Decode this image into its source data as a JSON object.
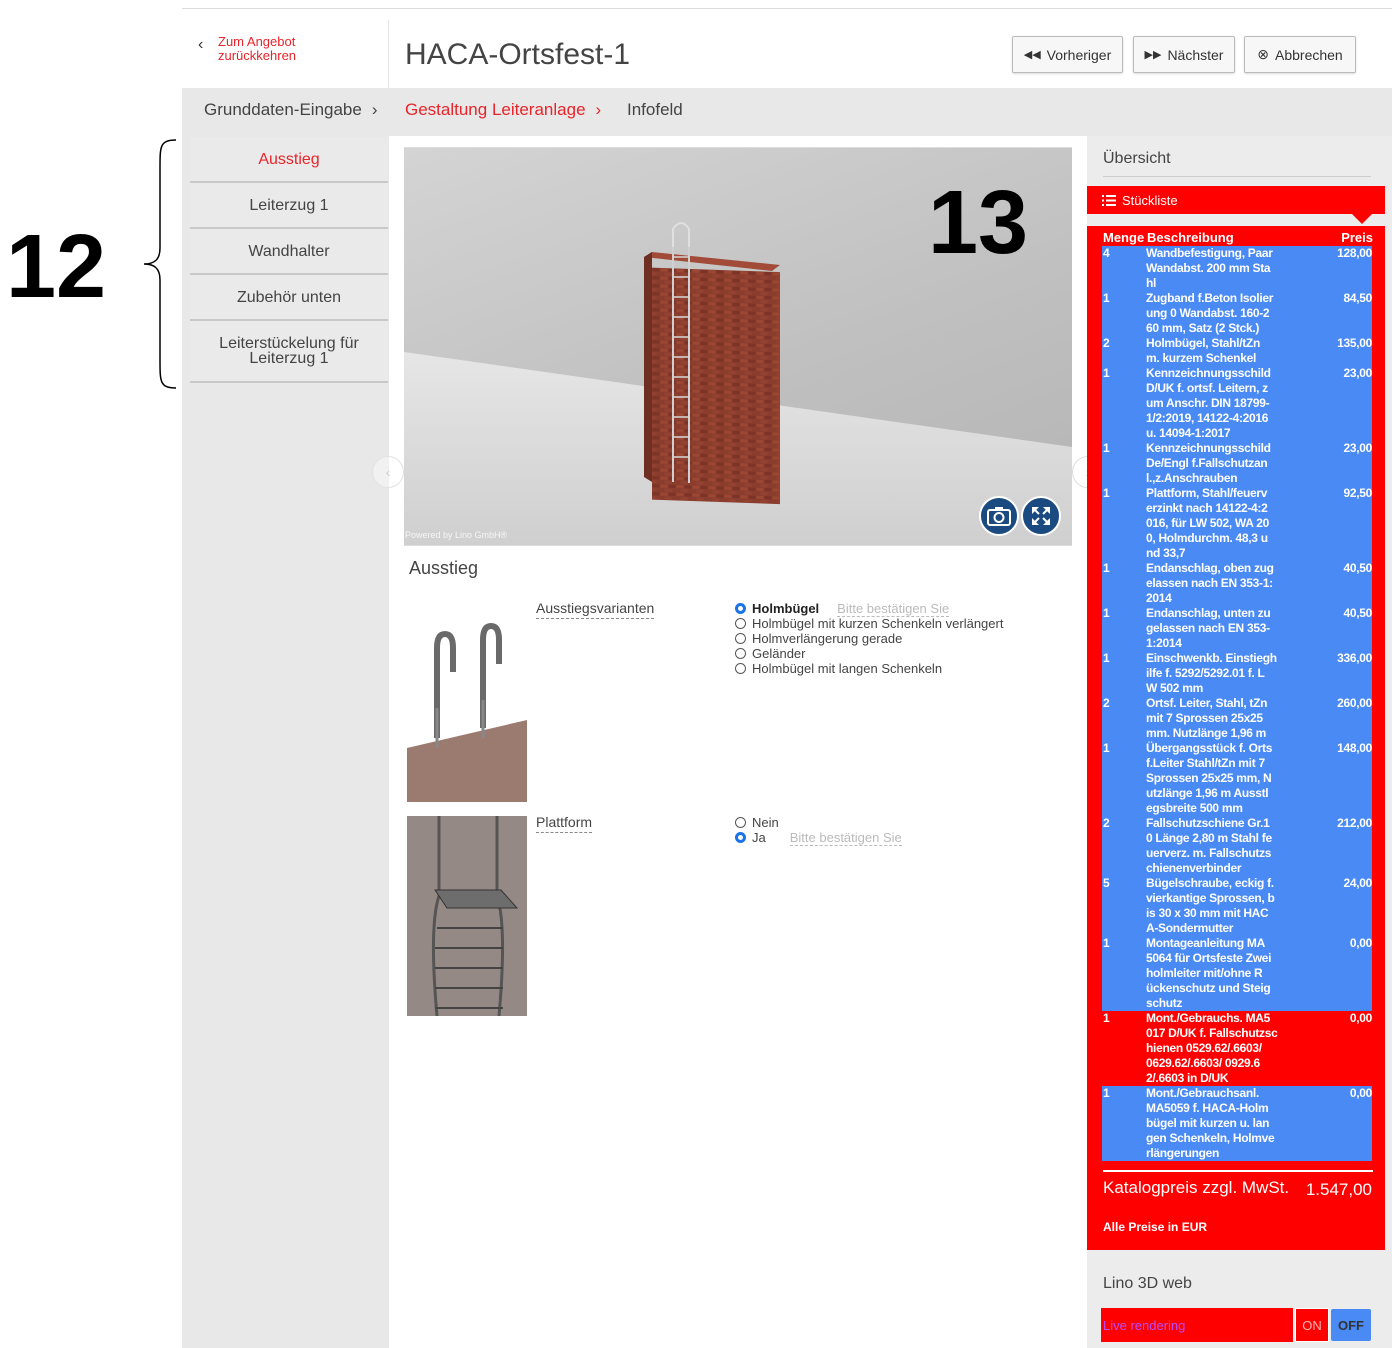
{
  "annotations": {
    "left": "12",
    "viewer": "13"
  },
  "header": {
    "back_label": "Zum Angebot zurückkehren",
    "title": "HACA-Ortsfest-1",
    "buttons": {
      "prev": "Vorheriger",
      "next": "Nächster",
      "cancel": "Abbrechen"
    }
  },
  "breadcrumb": {
    "steps": [
      {
        "label": "Grunddaten-Eingabe",
        "active": false
      },
      {
        "label": "Gestaltung Leiteranlage",
        "active": true
      },
      {
        "label": "Infofeld",
        "active": false
      }
    ]
  },
  "sidebar": {
    "items": [
      {
        "label": "Ausstieg",
        "active": true
      },
      {
        "label": "Leiterzug 1",
        "active": false
      },
      {
        "label": "Wandhalter",
        "active": false
      },
      {
        "label": "Zubehör unten",
        "active": false
      },
      {
        "label": "Leiterstückelung für Leiterzug 1",
        "active": false
      }
    ]
  },
  "viewer": {
    "powered_by": "Powered by Lino GmbH®",
    "camera_icon": "camera-icon",
    "fullscreen_icon": "expand-icon"
  },
  "section": {
    "title": "Ausstieg",
    "groups": [
      {
        "label": "Ausstiegsvarianten",
        "confirm": "Bitte bestätigen Sie",
        "options": [
          {
            "label": "Holmbügel",
            "selected": true
          },
          {
            "label": "Holmbügel mit kurzen Schenkeln verlängert",
            "selected": false
          },
          {
            "label": "Holmverlängerung gerade",
            "selected": false
          },
          {
            "label": "Geländer",
            "selected": false
          },
          {
            "label": "Holmbügel mit langen Schenkeln",
            "selected": false
          }
        ]
      },
      {
        "label": "Plattform",
        "confirm": "Bitte bestätigen Sie",
        "options": [
          {
            "label": "Nein",
            "selected": false
          },
          {
            "label": "Ja",
            "selected": true
          }
        ]
      }
    ]
  },
  "overview": {
    "title": "Übersicht",
    "stueckliste_label": "Stückliste",
    "columns": {
      "qty": "Menge",
      "desc": "Beschreibung",
      "price": "Preis"
    },
    "rows": [
      {
        "qty": "4",
        "desc": [
          "Wandbefestigung, Paar",
          "Wandabst. 200 mm Sta",
          "hl"
        ],
        "price": "128,00",
        "hl": true
      },
      {
        "qty": "1",
        "desc": [
          "Zugband f.Beton Isolier",
          "ung 0 Wandabst. 160-2",
          "60 mm, Satz (2 Stck.)"
        ],
        "price": "84,50",
        "hl": true
      },
      {
        "qty": "2",
        "desc": [
          "Holmbügel, Stahl/tZn",
          "m. kurzem Schenkel"
        ],
        "price": "135,00",
        "hl": true
      },
      {
        "qty": "1",
        "desc": [
          "Kennzeichnungsschild",
          "D/UK f. ortsf. Leitern, z",
          "um Anschr. DIN 18799-",
          "1/2:2019, 14122-4:2016",
          "u. 14094-1:2017"
        ],
        "price": "23,00",
        "hl": true
      },
      {
        "qty": "1",
        "desc": [
          "Kennzeichnungsschild",
          "De/Engl f.Fallschutzan",
          "l.,z.Anschrauben"
        ],
        "price": "23,00",
        "hl": true
      },
      {
        "qty": "1",
        "desc": [
          "Plattform, Stahl/feuerv",
          "erzinkt nach 14122-4:2",
          "016, für LW 502, WA 20",
          "0, Holmdurchm. 48,3 u",
          "nd 33,7"
        ],
        "price": "92,50",
        "hl": true
      },
      {
        "qty": "1",
        "desc": [
          "Endanschlag, oben zug",
          "elassen nach EN 353-1:",
          "2014"
        ],
        "price": "40,50",
        "hl": true
      },
      {
        "qty": "1",
        "desc": [
          "Endanschlag, unten zu",
          "gelassen nach EN 353-",
          "1:2014"
        ],
        "price": "40,50",
        "hl": true
      },
      {
        "qty": "1",
        "desc": [
          "Einschwenkb. Einstiegh",
          "ilfe f. 5292/5292.01 f. L",
          "W 502 mm"
        ],
        "price": "336,00",
        "hl": true
      },
      {
        "qty": "2",
        "desc": [
          "Ortsf. Leiter, Stahl, tZn",
          "mit 7 Sprossen 25x25",
          "mm. Nutzlänge 1,96 m"
        ],
        "price": "260,00",
        "hl": true
      },
      {
        "qty": "1",
        "desc": [
          "Übergangsstück f. Orts",
          "f.Leiter Stahl/tZn mit 7",
          "Sprossen 25x25 mm, N",
          "utzlänge 1,96 m Ausstl",
          "egsbreite 500 mm"
        ],
        "price": "148,00",
        "hl": true
      },
      {
        "qty": "2",
        "desc": [
          "Fallschutzschiene Gr.1",
          "0 Länge 2,80 m Stahl fe",
          "uerverz. m. Fallschutzs",
          "chienenverbinder"
        ],
        "price": "212,00",
        "hl": true
      },
      {
        "qty": "5",
        "desc": [
          "Bügelschraube, eckig f.",
          "vierkantige Sprossen, b",
          "is 30 x 30 mm mit HAC",
          "A-Sondermutter"
        ],
        "price": "24,00",
        "hl": true
      },
      {
        "qty": "1",
        "desc": [
          "Montageanleitung MA",
          "5064 für Ortsfeste Zwei",
          "holmleiter mit/ohne R",
          "ückenschutz und Steig",
          "schutz"
        ],
        "price": "0,00",
        "hl": true
      },
      {
        "qty": "1",
        "desc": [
          "Mont./Gebrauchs. MA5",
          "017 D/UK f. Fallschutzsc",
          "hienen 0529.62/.6603/",
          "0629.62/.6603/ 0929.6",
          "2/.6603 in D/UK"
        ],
        "price": "0,00",
        "hl": false
      },
      {
        "qty": "1",
        "desc": [
          "Mont./Gebrauchsanl.",
          "MA5059 f. HACA-Holm",
          "bügel mit kurzen u. lan",
          "gen Schenkeln, Holmve",
          "rlängerungen"
        ],
        "price": "0,00",
        "hl": true
      }
    ],
    "total_label": "Katalogpreis zzgl. MwSt.",
    "total_value": "1.547,00",
    "currency_note": "Alle Preise in EUR"
  },
  "lino": {
    "title": "Lino 3D web",
    "live_label": "Live rendering",
    "on": "ON",
    "off": "OFF"
  },
  "colors": {
    "accent": "#e8242a",
    "red": "#ff0000",
    "blue_highlight": "#4a8af4"
  }
}
